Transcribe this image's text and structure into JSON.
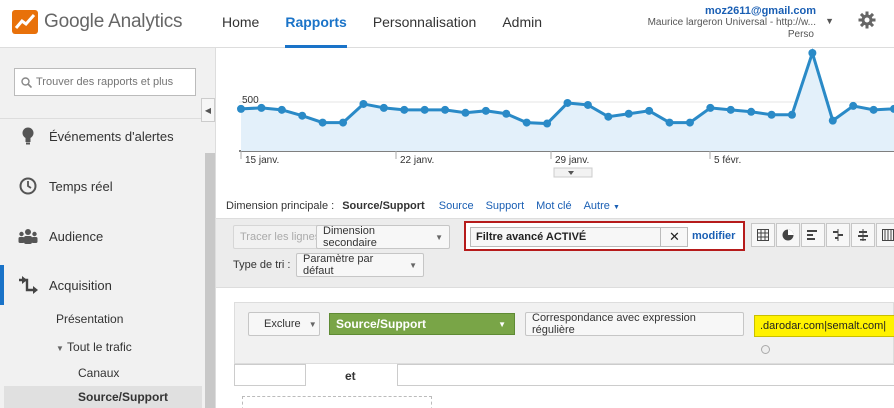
{
  "app": {
    "title": "Google Analytics"
  },
  "nav": [
    "Home",
    "Rapports",
    "Personnalisation",
    "Admin"
  ],
  "account": {
    "email": "moz2611@gmail.com",
    "name": "Maurice largeron Universal - http://w...",
    "view": "Perso"
  },
  "sidebar": {
    "search_placeholder": "Trouver des rapports et plus",
    "items": [
      {
        "label": "Événements d'alertes",
        "icon": "lightbulb-icon"
      },
      {
        "label": "Temps réel",
        "icon": "clock-icon"
      },
      {
        "label": "Audience",
        "icon": "people-icon"
      },
      {
        "label": "Acquisition",
        "icon": "acquisition-arrows-icon"
      }
    ],
    "sub_items": {
      "presentation": "Présentation",
      "tout_le_trafic": "Tout le trafic",
      "canaux": "Canaux",
      "source_support": "Source/Support"
    }
  },
  "chart": {
    "y_label": "500",
    "x_labels": [
      "15 janv.",
      "22 janv.",
      "29 janv.",
      "5 févr."
    ],
    "series_color": "#2a8ac7"
  },
  "chart_data": {
    "type": "area",
    "ylim": [
      0,
      1000
    ],
    "yticks": [
      500
    ],
    "x_tick_labels": [
      "15 janv.",
      "22 janv.",
      "29 janv.",
      "5 févr."
    ],
    "values": [
      430,
      440,
      420,
      360,
      290,
      290,
      480,
      440,
      420,
      420,
      420,
      390,
      410,
      380,
      290,
      280,
      490,
      470,
      350,
      380,
      410,
      290,
      290,
      440,
      420,
      400,
      370,
      370,
      1000,
      310,
      460,
      420,
      430
    ]
  },
  "report": {
    "dim_label": "Dimension principale :",
    "dim_current": "Source/Support",
    "dim_links": [
      "Source",
      "Support",
      "Mot clé",
      "Autre"
    ],
    "plot_rows": "Tracer les lignes",
    "secondary_dim": "Dimension secondaire",
    "filter_text": "Filtre avancé ACTIVÉ",
    "filter_modify": "modifier",
    "sort_label": "Type de tri :",
    "sort_value": "Paramètre par défaut"
  },
  "filter_panel": {
    "exclude": "Exclure",
    "dimension": "Source/Support",
    "match": "Correspondance avec expression régulière",
    "expression": ".darodar.com|semalt.com|",
    "and_label": "et"
  }
}
